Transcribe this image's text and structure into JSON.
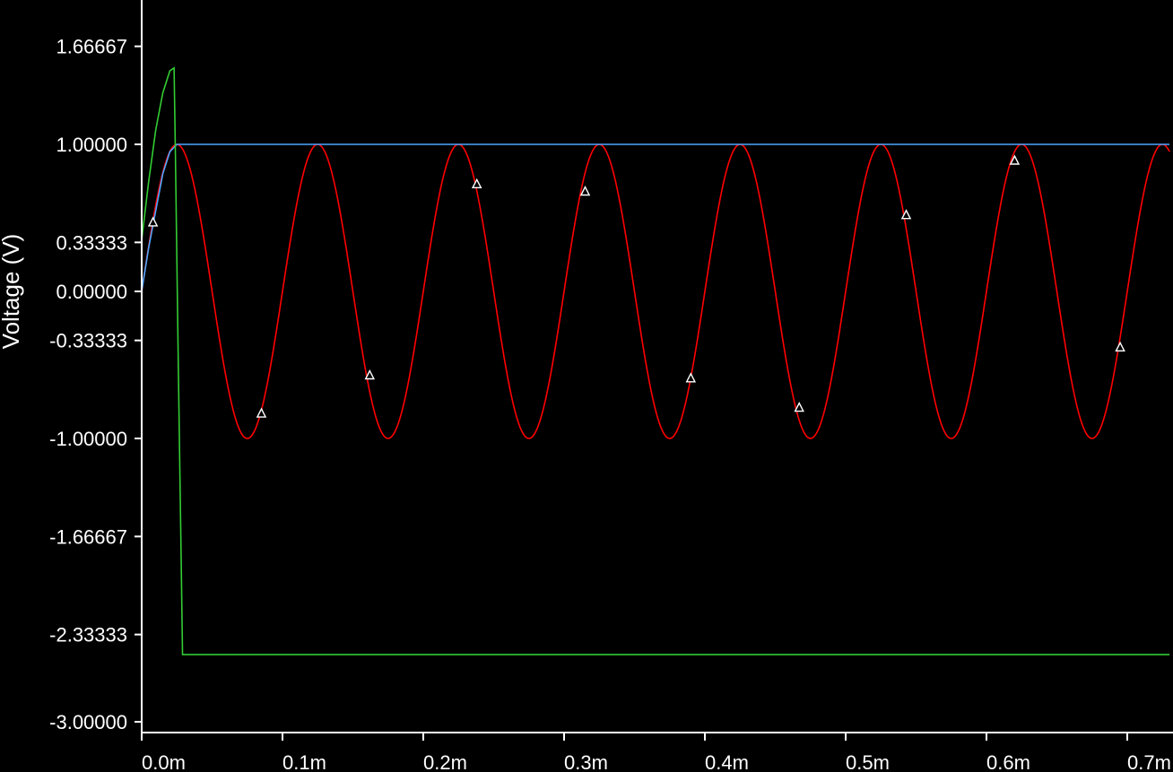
{
  "chart_data": {
    "type": "line",
    "title": "",
    "xlabel": "",
    "ylabel": "Voltage (V)",
    "xlim": [
      0.0,
      0.00073
    ],
    "ylim": [
      -3.0,
      2.0
    ],
    "x_ticks": [
      0.0,
      0.0001,
      0.0002,
      0.0003,
      0.0004,
      0.0005,
      0.0006,
      0.0007
    ],
    "x_tick_labels": [
      "0.0m",
      "0.1m",
      "0.2m",
      "0.3m",
      "0.4m",
      "0.5m",
      "0.6m",
      "0.7m"
    ],
    "y_ticks": [
      1.66667,
      1.0,
      0.33333,
      0.0,
      -0.33333,
      -1.0,
      -1.66667,
      -2.33333,
      -3.0
    ],
    "y_tick_labels": [
      "1.66667",
      "1.00000",
      "0.33333",
      "0.00000",
      "-0.33333",
      "-1.00000",
      "-1.66667",
      "-2.33333",
      "-3.00000"
    ],
    "grid": false,
    "legend": "none",
    "background": "#000000",
    "axis_color": "#ffffff",
    "series": [
      {
        "color": "#ff0000",
        "x": [
          0.0,
          1e-05,
          2e-05,
          2.5e-05,
          3e-05,
          4e-05,
          5e-05,
          6e-05,
          7.5e-05,
          9e-05,
          0.0001,
          0.00011,
          0.000125,
          0.00014,
          0.00015,
          0.00016,
          0.000175,
          0.00019,
          0.0002,
          0.00021,
          0.000225,
          0.00024,
          0.00025,
          0.00026,
          0.000275,
          0.00029,
          0.0003,
          0.00031,
          0.000325,
          0.00034,
          0.00035,
          0.00036,
          0.000375,
          0.00039,
          0.0004,
          0.00041,
          0.000425,
          0.00044,
          0.00045,
          0.00046,
          0.000475,
          0.00049,
          0.0005,
          0.00051,
          0.000525,
          0.00054,
          0.00055,
          0.00056,
          0.000575,
          0.00059,
          0.0006,
          0.00061,
          0.000625,
          0.00064,
          0.00065,
          0.00066,
          0.000675,
          0.00069,
          0.0007,
          0.00071,
          0.000725,
          0.00073
        ],
        "y": [
          0.0,
          0.59,
          0.95,
          1.0,
          0.95,
          0.59,
          0.0,
          -0.59,
          -1.0,
          -0.59,
          0.0,
          0.59,
          1.0,
          0.59,
          0.0,
          -0.59,
          -1.0,
          -0.59,
          0.0,
          0.59,
          1.0,
          0.59,
          0.0,
          -0.59,
          -1.0,
          -0.59,
          0.0,
          0.59,
          1.0,
          0.59,
          0.0,
          -0.59,
          -1.0,
          -0.59,
          0.0,
          0.59,
          1.0,
          0.59,
          0.0,
          -0.59,
          -1.0,
          -0.59,
          0.0,
          0.59,
          1.0,
          0.59,
          0.0,
          -0.59,
          -1.0,
          -0.59,
          0.0,
          0.59,
          1.0,
          0.59,
          0.0,
          -0.59,
          -1.0,
          -0.59,
          0.0,
          0.59,
          1.0,
          0.59
        ]
      },
      {
        "color": "#4da6ff",
        "x": [
          0.0,
          5e-06,
          1e-05,
          1.5e-05,
          2e-05,
          2.5e-05,
          3e-05,
          0.00073
        ],
        "y": [
          0.0,
          0.3,
          0.55,
          0.8,
          0.95,
          1.0,
          1.0,
          1.0
        ]
      },
      {
        "color": "#33cc33",
        "x": [
          0.0,
          5e-06,
          1e-05,
          1.5e-05,
          2e-05,
          2.3e-05,
          2.4e-05,
          2.6e-05,
          2.8e-05,
          2.9e-05,
          0.00073
        ],
        "y": [
          0.35,
          0.75,
          1.1,
          1.35,
          1.5,
          1.52,
          0.9,
          -0.5,
          -1.8,
          -2.47,
          -2.47
        ]
      }
    ],
    "markers": {
      "symbol": "triangle",
      "color": "#ffffff",
      "x": [
        8e-06,
        8.5e-05,
        0.000162,
        0.000238,
        0.000315,
        0.00039,
        0.000467,
        0.000543,
        0.00062,
        0.000695
      ],
      "y": [
        0.47,
        -0.83,
        -0.57,
        0.73,
        0.68,
        -0.59,
        -0.79,
        0.52,
        0.89,
        -0.38
      ]
    }
  }
}
